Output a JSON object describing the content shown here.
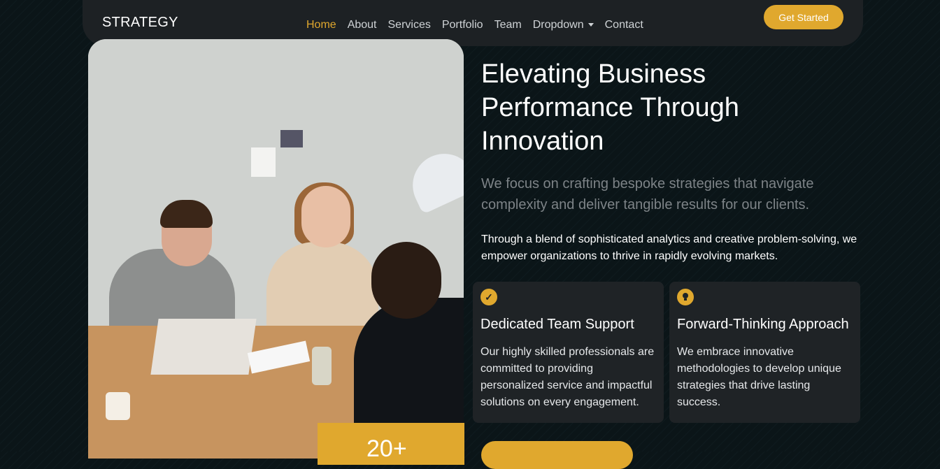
{
  "brand": "STRATEGY",
  "nav": {
    "items": [
      "Home",
      "About",
      "Services",
      "Portfolio",
      "Team",
      "Dropdown",
      "Contact"
    ],
    "active": "Home"
  },
  "cta_label": "Get Started",
  "hero": {
    "title": "Elevating Business Performance Through Innovation",
    "lead": "We focus on crafting bespoke strategies that navigate complexity and deliver tangible results for our clients.",
    "body": "Through a blend of sophisticated analytics and creative problem-solving, we empower organizations to thrive in rapidly evolving markets."
  },
  "features": [
    {
      "icon": "check-circle-icon",
      "title": "Dedicated Team Support",
      "text": "Our highly skilled professionals are committed to providing personalized service and impactful solutions on every engagement."
    },
    {
      "icon": "lightbulb-icon",
      "title": "Forward-Thinking Approach",
      "text": "We embrace innovative methodologies to develop unique strategies that drive lasting success."
    }
  ],
  "stat_number": "20+",
  "colors": {
    "accent": "#e0a82e",
    "background": "#0b1518",
    "navbar": "#1d2124",
    "card": "#1f2326"
  }
}
